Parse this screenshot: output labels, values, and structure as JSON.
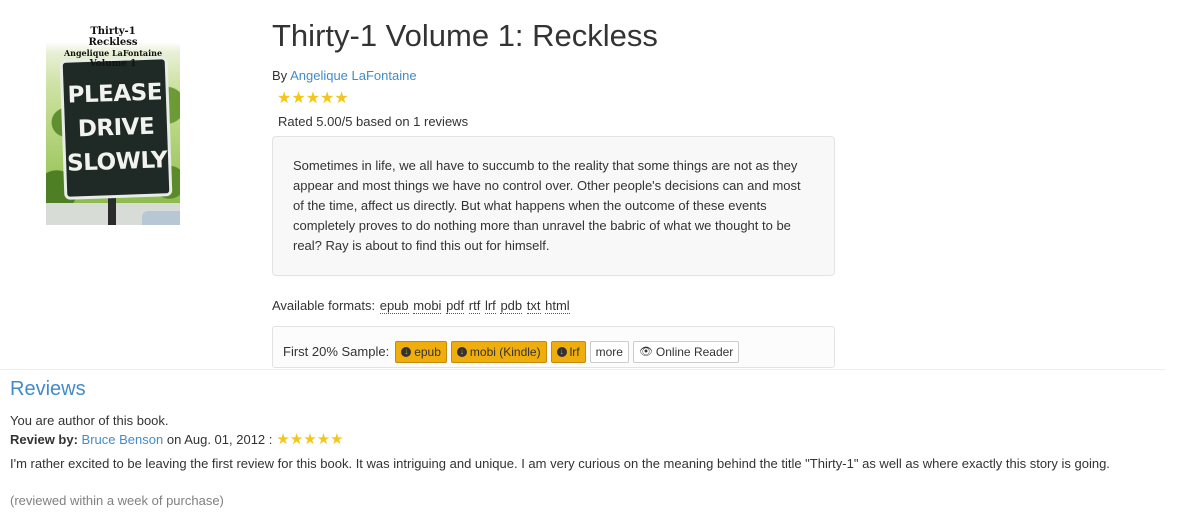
{
  "cover": {
    "overlay_title": "Thirty-1",
    "overlay_subtitle": "Reckless",
    "overlay_author": "Angelique LaFontaine",
    "overlay_volume": "Volume 1",
    "sign_lines": [
      "PLEASE",
      "DRIVE",
      "SLOWLY"
    ]
  },
  "book": {
    "title": "Thirty-1 Volume 1: Reckless",
    "by_label": "By",
    "author": "Angelique LaFontaine",
    "rating_stars": "★★★★★",
    "rating_text": "Rated 5.00/5 based on 1 reviews",
    "description": "Sometimes in life, we all have to succumb to the reality that some things are not as they appear and most things we have no control over. Other people's decisions can and most of the time, affect us directly. But what happens when the outcome of these events completely proves to do nothing more than unravel the babric of what we thought to be real? Ray is about to find this out for himself."
  },
  "formats": {
    "label": "Available formats:",
    "items": [
      "epub",
      "mobi",
      "pdf",
      "rtf",
      "lrf",
      "pdb",
      "txt",
      "html"
    ]
  },
  "sample": {
    "label": "First 20% Sample:",
    "buttons": {
      "epub": "epub",
      "mobi": "mobi (Kindle)",
      "lrf": "lrf",
      "more": "more",
      "reader": "Online Reader"
    }
  },
  "reviews": {
    "heading": "Reviews",
    "author_note": "You are author of this book.",
    "items": [
      {
        "by_label": "Review by:",
        "reviewer": "Bruce Benson",
        "date_text": "on Aug. 01, 2012 :",
        "stars": "★★★★★",
        "text": "I'm rather excited to be leaving the first review for this book. It was intriguing and unique. I am very curious on the meaning behind the title \"Thirty-1\" as well as where exactly this story is going.",
        "note": "(reviewed within a week of purchase)"
      }
    ]
  },
  "colors": {
    "link": "#428bca",
    "star": "#f5c518",
    "download_button": "#f0ad0e",
    "muted_text": "#808080"
  }
}
